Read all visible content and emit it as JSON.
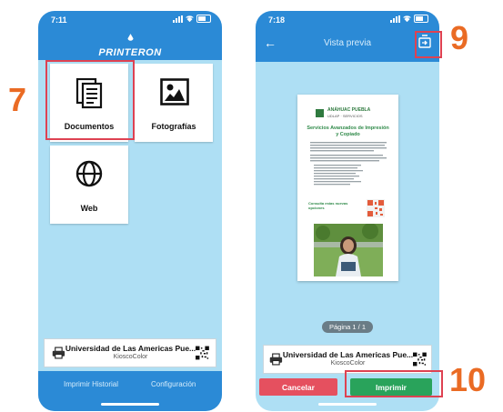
{
  "left_screen": {
    "status_time": "7:11",
    "brand": "PRINTERON",
    "tiles": [
      {
        "label": "Documentos",
        "icon": "document-icon"
      },
      {
        "label": "Fotografías",
        "icon": "photo-icon"
      },
      {
        "label": "Web",
        "icon": "globe-icon"
      }
    ],
    "printer": {
      "name": "Universidad de Las Americas Pue...",
      "subtitle": "KioscoColor",
      "icon": "printer-icon",
      "qr": "qr-code-icon"
    },
    "bottom_links": {
      "history": "Imprimir Historial",
      "settings": "Configuración"
    }
  },
  "right_screen": {
    "status_time": "7:18",
    "title": "Vista previa",
    "page_indicator": "Página 1 / 1",
    "printer": {
      "name": "Universidad de Las Americas Pue...",
      "subtitle": "KioscoColor"
    },
    "buttons": {
      "cancel": "Cancelar",
      "print": "Imprimir"
    },
    "document": {
      "header_line": "ANÁHUAC PUEBLA",
      "header_sub": "UDLAP · SERVICIOS",
      "heading": "Servicios Avanzados de Impresión y Copiado",
      "cta": "Consulta estas nuevas opciones"
    }
  },
  "annotations": {
    "step_7": "7",
    "step_9": "9",
    "step_10": "10"
  },
  "colors": {
    "header_blue": "#2b8ad6",
    "background_blue": "#aedff4",
    "cancel_red": "#e5505f",
    "print_green": "#29a35b",
    "highlight": "#de4252",
    "step_orange": "#ea6b24"
  }
}
